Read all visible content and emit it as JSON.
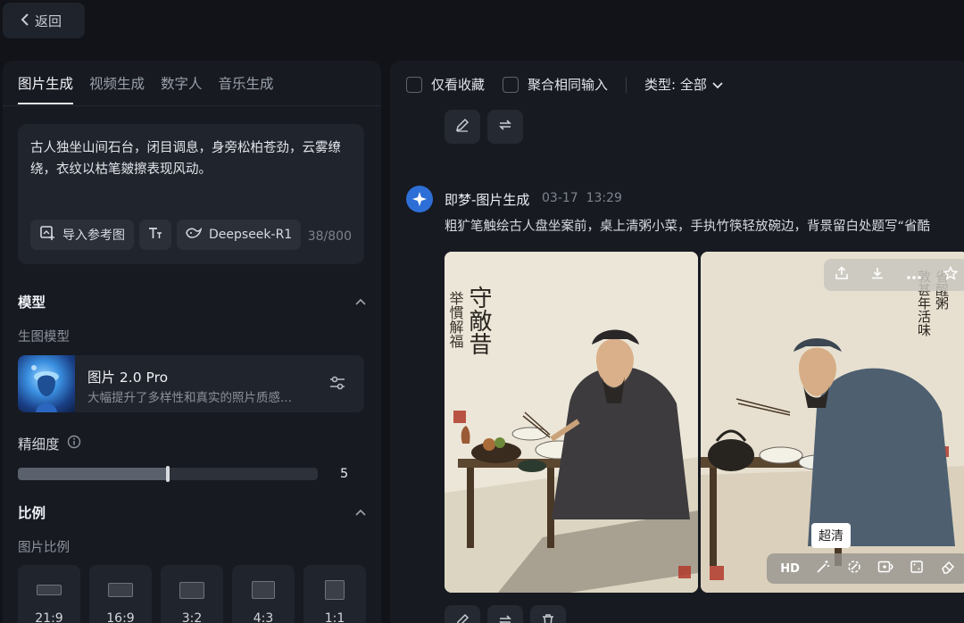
{
  "back": {
    "label": "返回"
  },
  "left": {
    "tabs": [
      "图片生成",
      "视频生成",
      "数字人",
      "音乐生成"
    ],
    "prompt": {
      "text": "古人独坐山间石台，闭目调息，身旁松柏苍劲，云雾缭绕，衣纹以枯笔皴擦表现风动。",
      "import_ref": "导入参考图",
      "text_style_icon": "text-format-icon",
      "model_chip": "Deepseek-R1",
      "counter": "38/800"
    },
    "model_section": {
      "title": "模型",
      "sub": "生图模型",
      "model_name": "图片 2.0 Pro",
      "model_desc": "大幅提升了多样性和真实的照片质感..."
    },
    "detail": {
      "label": "精细度",
      "value": "5",
      "fraction": 0.5
    },
    "ratio_section": {
      "title": "比例",
      "sub": "图片比例",
      "ratios": [
        "21:9",
        "16:9",
        "3:2",
        "4:3",
        "1:1"
      ]
    }
  },
  "right": {
    "filters": {
      "favorites": "仅看收藏",
      "merge": "聚合相同输入",
      "type": "类型: 全部"
    },
    "gen": {
      "title": "即梦-图片生成",
      "date": "03-17",
      "time": "13:29",
      "prompt": "粗犷笔触绘古人盘坐案前，桌上清粥小菜，手执竹筷轻放碗边，背景留白处题写“省酷"
    },
    "image_tools": {
      "hd": "HD",
      "tooltip": "超清"
    },
    "calligraphy": {
      "big": "守敵昔",
      "small": "举慣解福"
    }
  },
  "colors": {
    "accent": "#2d6fd6",
    "panel": "#171a21",
    "card": "#20242c"
  }
}
